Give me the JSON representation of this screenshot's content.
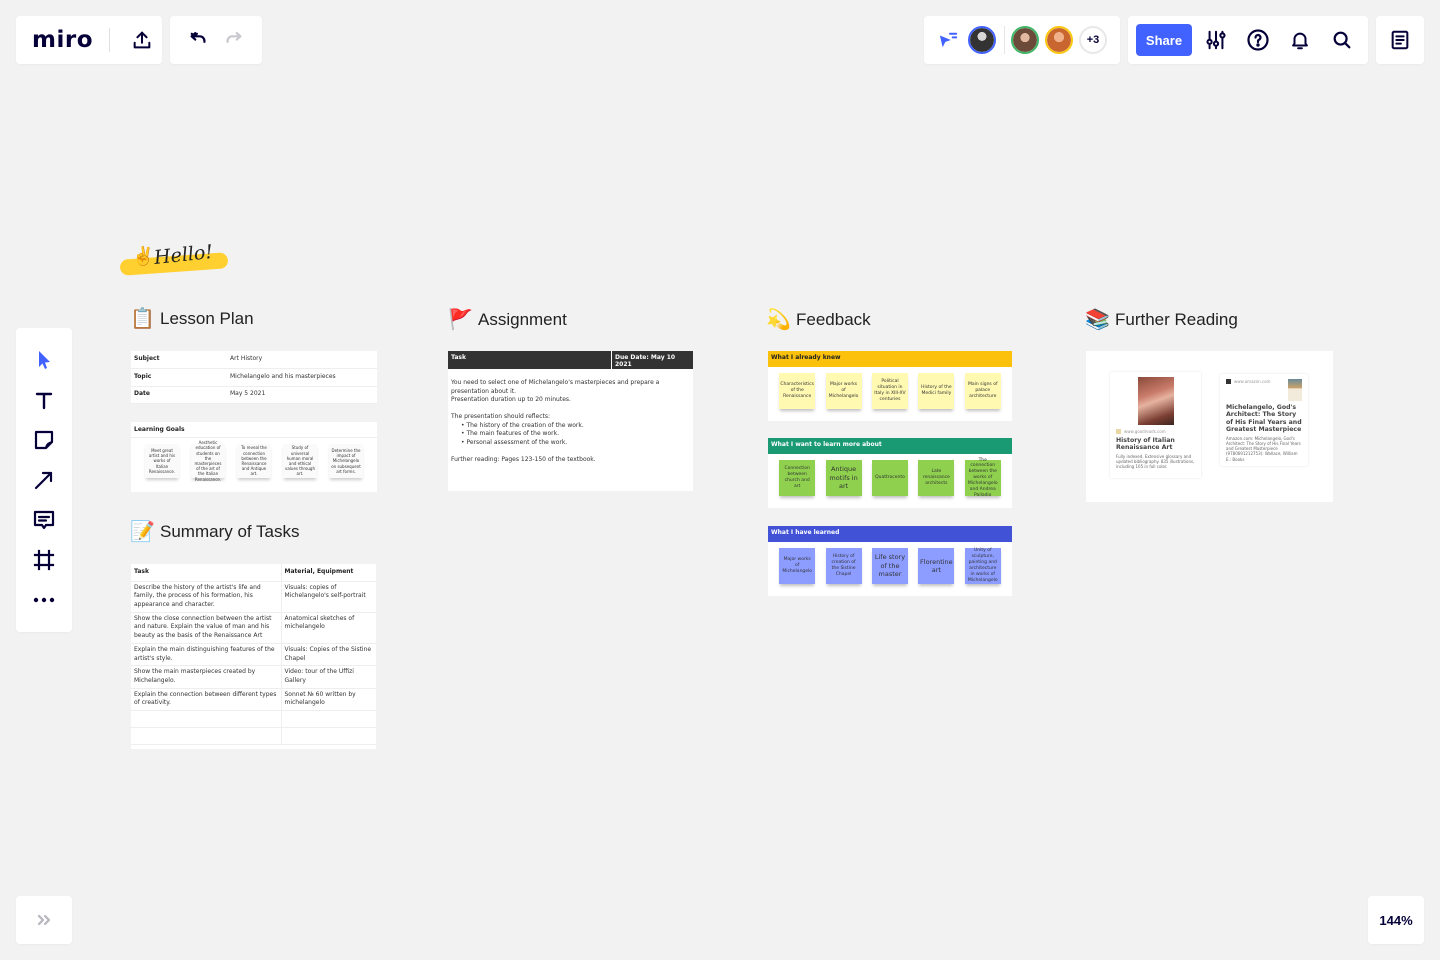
{
  "app": {
    "logo": "miro",
    "zoom_level": "144%",
    "share_label": "Share",
    "collaborators_more": "+3",
    "colors": {
      "accent": "#4262ff",
      "sticky_yellow": "#fff9b1",
      "sticky_green": "#8fd14f",
      "sticky_blue": "#8c9cff"
    }
  },
  "topbar": {
    "icons": [
      "export-icon",
      "undo-icon",
      "redo-icon",
      "follow-cursor-icon",
      "settings-sliders-icon",
      "help-icon",
      "notifications-icon",
      "search-icon",
      "board-list-icon"
    ]
  },
  "collaborators": [
    {
      "name": "collaborator-1",
      "ring": "#4262ff",
      "fill": "#555"
    },
    {
      "name": "collaborator-2",
      "ring": "#3fb565",
      "fill": "#7a5a4a"
    },
    {
      "name": "collaborator-3",
      "ring": "#fac710",
      "fill": "#d98a5f"
    }
  ],
  "toolbar": {
    "tools": [
      "select-tool",
      "text-tool",
      "sticky-note-tool",
      "connection-line-tool",
      "comment-tool",
      "frame-tool",
      "more-tools"
    ]
  },
  "board": {
    "hello_text": "Hello!",
    "hello_emoji": "✌️",
    "lesson_plan": {
      "title": "Lesson Plan",
      "emoji": "📋",
      "rows": [
        {
          "label": "Subject",
          "value": "Art History"
        },
        {
          "label": "Topic",
          "value": "Michelangelo and his masterpieces"
        },
        {
          "label": "Date",
          "value": "May 5 2021"
        }
      ],
      "goals_title": "Learning Goals",
      "goals": [
        "Meet great artist and his works of Italian Renaissance.",
        "Aesthetic education of students on the masterpieces of the art of the Italian Renaissance.",
        "To reveal the connection between the Renaissance and Antique art.",
        "Study of universal human moral and ethical values through art.",
        "Determine the impact of Michelangelo on subsequent art forms."
      ]
    },
    "summary": {
      "title": "Summary of Tasks",
      "emoji": "📝",
      "headers": [
        "Task",
        "Material, Equipment"
      ],
      "rows": [
        [
          "Describe the history of the artist's life and family, the process of his formation, his appearance and character.",
          "Visuals: copies of Michelangelo's self-portrait"
        ],
        [
          "Show the close connection between the artist and nature. Explain the value of man and his beauty as the basis of the Renaissance Art",
          "Anatomical sketches of michelangelo"
        ],
        [
          "Explain the main distinguishing features of the artist's style.",
          "Visuals: Copies of the Sistine Chapel"
        ],
        [
          "Show the main masterpieces created by Michelangelo.",
          "Video: tour of the Uffizi Gallery"
        ],
        [
          "Explain the connection between different types of creativity.",
          "Sonnet № 60  written by michelangelo"
        ],
        [
          "",
          ""
        ],
        [
          "",
          ""
        ]
      ]
    },
    "assignment": {
      "title": "Assignment",
      "emoji": "🚩",
      "header_task": "Task",
      "header_due": "Due Date: May 10 2021",
      "para1": "You need to select one of Michelangelo's masterpieces and prepare a presentation about it.",
      "para2": "Presentation duration up to 20 minutes.",
      "reflects": "The presentation should reflects:",
      "bullets": [
        "The history of the creation of the work.",
        "The main features of the work.",
        "Personal assessment of the work."
      ],
      "further": "Further reading: Pages 123-150 of the textbook."
    },
    "feedback": {
      "title": "Feedback",
      "emoji": "💫",
      "groups": [
        {
          "label": "What I already knew",
          "header_color": "#fcc10a",
          "header_text_color": "#222",
          "sticky_color": "#fff9b1",
          "notes": [
            "Characteristics of the Renaissance",
            "Major works of Michelangelo",
            "Political situation in Italy in XIII-XV centuries",
            "History of the Medici family",
            "Main signs of palace architecture"
          ]
        },
        {
          "label": "What I want to learn more about",
          "header_color": "#1a9a73",
          "header_text_color": "#fff",
          "sticky_color": "#8fd14f",
          "notes": [
            "Connection between church and art",
            "Antique motifs in art",
            "Quattrocento",
            "Late renaissance architects",
            "The connection between the works of Michelangelo and Andrea Palladio"
          ]
        },
        {
          "label": "What I have learned",
          "header_color": "#4152d6",
          "header_text_color": "#fff",
          "sticky_color": "#8c9cff",
          "notes": [
            "Major works of Michelangelo",
            "History of creation of the Sistine Chapel",
            "Life story of the master",
            "Florentine art",
            "Unity of sculpture, painting and architecture in works of Michelangelo"
          ]
        }
      ]
    },
    "further_reading": {
      "title": "Further Reading",
      "emoji": "📚",
      "books": [
        {
          "site": "www.goodreads.com",
          "title": "History of Italian Renaissance Art",
          "desc": "Fully indexed. Extensive glossary and updated bibliography. 835 illustrations, including 105 in full color."
        },
        {
          "site": "www.amazon.com",
          "title": "Michelangelo, God's Architect: The Story of His Final Years and Greatest Masterpiece",
          "desc": "Amazon.com: Michelangelo, God's Architect: The Story of His Final Years and Greatest Masterpiece (9780691212753): Wallace, William E.: Books"
        }
      ]
    }
  }
}
